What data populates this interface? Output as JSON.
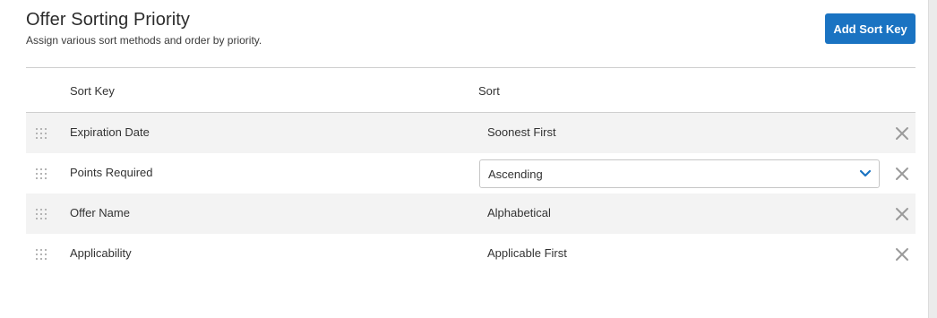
{
  "header": {
    "title": "Offer Sorting Priority",
    "subtitle": "Assign various sort methods and order by priority.",
    "add_button_label": "Add Sort Key"
  },
  "table": {
    "columns": {
      "sort_key": "Sort Key",
      "sort": "Sort"
    },
    "rows": [
      {
        "key": "Expiration Date",
        "sort": "Soonest First",
        "editing": false
      },
      {
        "key": "Points Required",
        "sort": "Ascending",
        "editing": true
      },
      {
        "key": "Offer Name",
        "sort": "Alphabetical",
        "editing": false
      },
      {
        "key": "Applicability",
        "sort": "Applicable First",
        "editing": false
      }
    ]
  },
  "icons": {
    "drag": "drag-handle-icon",
    "remove": "close-icon",
    "dropdown": "chevron-down-icon"
  },
  "colors": {
    "accent": "#1a73c2",
    "stripe": "#f3f3f3",
    "icon_gray": "#9a9a9a"
  }
}
